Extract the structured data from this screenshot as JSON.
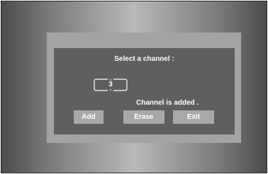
{
  "dialog": {
    "title": "Select a channel :",
    "channel_value": "3",
    "status_message": "Channel is added .",
    "buttons": {
      "add": "Add",
      "erase": "Erase",
      "exit": "Exit"
    }
  }
}
